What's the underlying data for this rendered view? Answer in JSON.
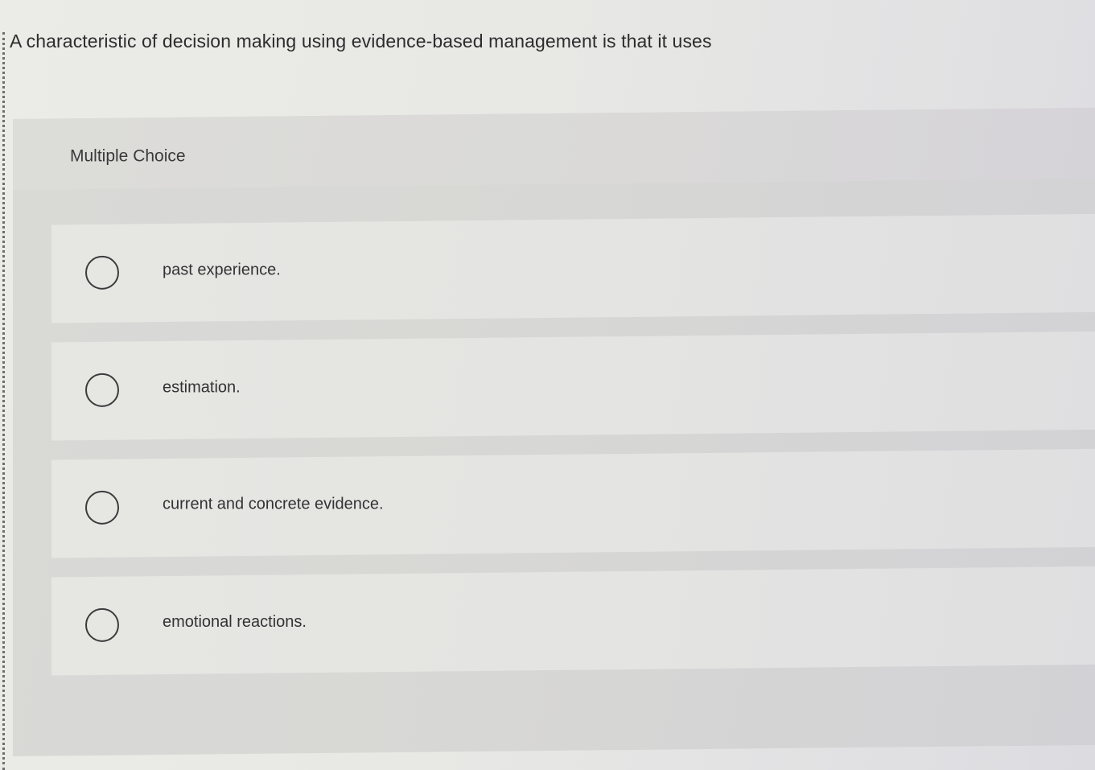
{
  "question": {
    "text": "A characteristic of decision making using evidence-based management is that it uses"
  },
  "choice_panel": {
    "label": "Multiple Choice",
    "options": [
      {
        "label": "past experience.",
        "selected": false
      },
      {
        "label": "estimation.",
        "selected": false
      },
      {
        "label": "current and concrete evidence.",
        "selected": false
      },
      {
        "label": "emotional reactions.",
        "selected": false
      }
    ]
  }
}
